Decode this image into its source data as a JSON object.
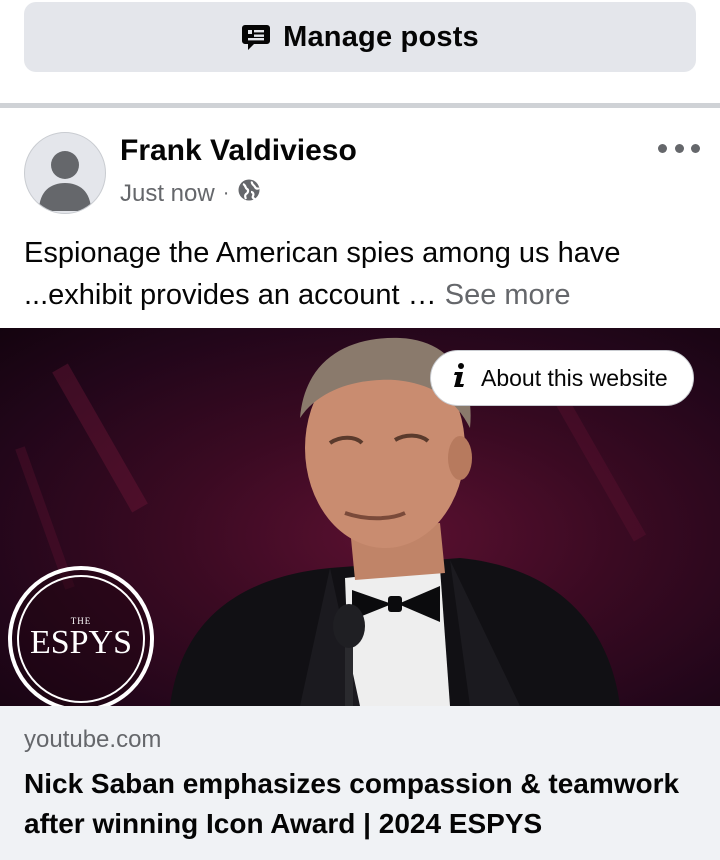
{
  "manage": {
    "label": "Manage posts",
    "icon": "message-lines-icon"
  },
  "post": {
    "author": "Frank Valdivieso",
    "time": "Just now",
    "separator": "·",
    "audience_icon": "globe-icon",
    "text": "Espionage the American spies among us have ...exhibit provides an account … ",
    "see_more": "See more",
    "media": {
      "about_label": "About this website",
      "logo_small": "THE",
      "logo_word": "ESPYS"
    },
    "link": {
      "domain": "youtube.com",
      "title": "Nick Saban emphasizes compassion & teamwork after winning Icon Award | 2024 ESPYS"
    }
  },
  "colors": {
    "button_bg": "#e4e6eb",
    "secondary_text": "#65676b",
    "footer_bg": "#f0f2f5"
  }
}
